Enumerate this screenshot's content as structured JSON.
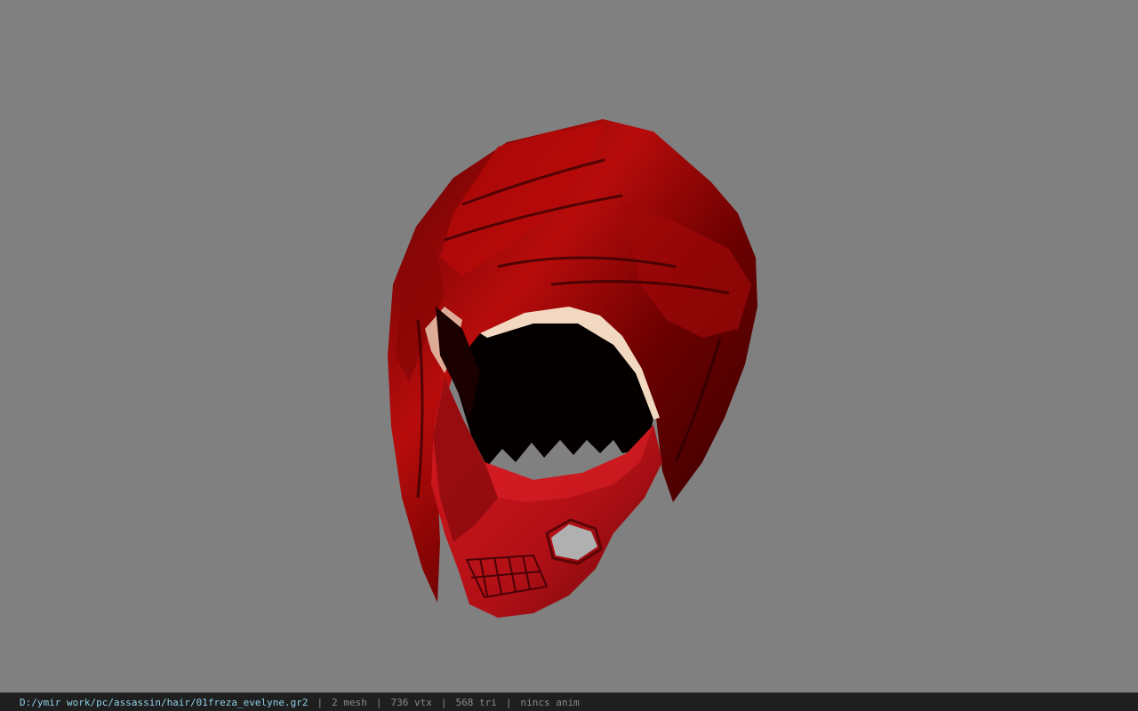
{
  "app": {
    "background_color": "#808080"
  },
  "viewport": {
    "model": "hair-mask-model",
    "model_colors": {
      "hair_dark": "#3a0000",
      "hair_mid": "#8a0000",
      "hair_bright": "#d01010",
      "mask": "#c8141a",
      "skin": "#f2d8c0"
    }
  },
  "status_bar": {
    "file_path": "D:/ymir work/pc/assassin/hair/01freza_evelyne.gr2",
    "separator": "|",
    "mesh": "2 mesh",
    "vertices": "736 vtx",
    "triangles": "568 tri",
    "anim": "nincs anim",
    "colors": {
      "background": "#1f1f1f",
      "path_text": "#8fd0e8",
      "info_text": "#8a8a8a"
    }
  }
}
